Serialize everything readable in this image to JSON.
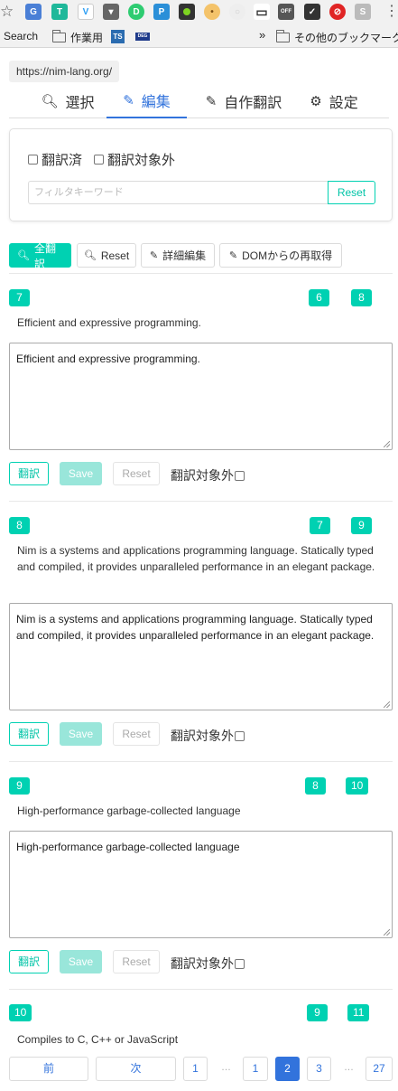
{
  "browser": {
    "bookmark_search": "Search",
    "bookmark_folder_1": "作業用",
    "bookmark_ts": "TS",
    "bookmark_deg": "DEG",
    "bookmark_more": "»",
    "bookmark_other": "その他のブックマーク",
    "ext_off_label": "OFF"
  },
  "page": {
    "url": "https://nim-lang.org/",
    "tabs": [
      {
        "label": "選択",
        "icon": "search-icon"
      },
      {
        "label": "編集",
        "icon": "pencil-icon",
        "active": true
      },
      {
        "label": "自作翻訳",
        "icon": "pencil-icon"
      },
      {
        "label": "設定",
        "icon": "gears-icon"
      }
    ],
    "filter": {
      "translated_label": "翻訳済",
      "excluded_label": "翻訳対象外",
      "keyword_placeholder": "フィルタキーワード",
      "reset_label": "Reset"
    },
    "toolbar": {
      "translate_all": "全翻訳",
      "reset": "Reset",
      "detail_edit": "詳細編集",
      "refetch_dom": "DOMからの再取得"
    },
    "entries": [
      {
        "id": "7",
        "prev": "6",
        "next": "8",
        "source": "Efficient and expressive programming.",
        "edit": "Efficient and expressive programming."
      },
      {
        "id": "8",
        "prev": "7",
        "next": "9",
        "source": "Nim is a systems and applications programming language. Statically typed and compiled, it provides unparalleled performance in an elegant package.",
        "edit": "Nim is a systems and applications programming language. Statically typed and compiled, it provides unparalleled performance in an elegant package."
      },
      {
        "id": "9",
        "prev": "8",
        "next": "10",
        "source": "High-performance garbage-collected language",
        "edit": "High-performance garbage-collected language"
      },
      {
        "id": "10",
        "prev": "9",
        "next": "11",
        "source": "Compiles to C, C++ or JavaScript"
      }
    ],
    "row_buttons": {
      "translate": "翻訳",
      "save": "Save",
      "reset": "Reset",
      "exclude": "翻訳対象外"
    },
    "pagination": {
      "prev": "前",
      "next": "次",
      "first": "1",
      "ellipsis": "…",
      "pages": [
        "1",
        "2",
        "3"
      ],
      "current": "2",
      "last": "27"
    }
  },
  "colors": {
    "primary": "#00d1b2",
    "link": "#3273dc"
  }
}
